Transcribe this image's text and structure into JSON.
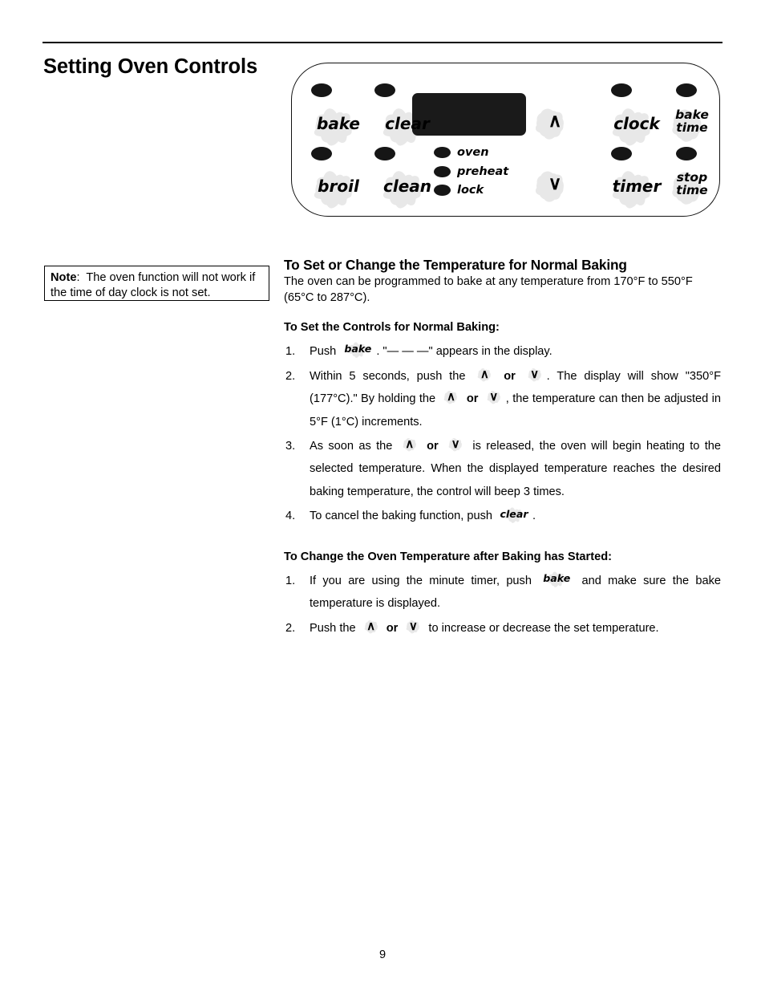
{
  "page": {
    "title": "Setting Oven Controls",
    "number": "9"
  },
  "control_panel": {
    "keys": [
      {
        "id": "bake",
        "label": "bake",
        "has_led": true
      },
      {
        "id": "clear",
        "label": "clear",
        "has_led": true
      },
      {
        "id": "up",
        "label": "∧",
        "has_led": false
      },
      {
        "id": "clock",
        "label": "clock",
        "has_led": true
      },
      {
        "id": "bake-time",
        "label": "bake time",
        "label_line1": "bake",
        "label_line2": "time",
        "has_led": true
      },
      {
        "id": "broil",
        "label": "broil",
        "has_led": true
      },
      {
        "id": "clean",
        "label": "clean",
        "has_led": true
      },
      {
        "id": "down",
        "label": "∨",
        "has_led": false
      },
      {
        "id": "timer",
        "label": "timer",
        "has_led": true
      },
      {
        "id": "stop-time",
        "label": "stop time",
        "label_line1": "stop",
        "label_line2": "time",
        "has_led": true
      }
    ],
    "indicators": [
      {
        "id": "oven",
        "label": "oven"
      },
      {
        "id": "preheat",
        "label": "preheat"
      },
      {
        "id": "lock",
        "label": "lock"
      }
    ],
    "display_window": {
      "label": "digital-display",
      "content": ""
    },
    "colors": {
      "led": "#161616",
      "display": "#1a1a1a",
      "splat": "#e8e8e8",
      "outline": "#111111"
    }
  },
  "note": {
    "label": "Note",
    "separator": ":",
    "text": "The oven function will not work if the time of day clock is not set."
  },
  "section": {
    "title": "To Set or Change the Temperature for Normal Baking",
    "lead": "The oven can be programmed to bake at any temperature from 170°F to 550°F (65°C to 287°C)."
  },
  "procedure_1": {
    "heading": "To Set the Controls for Normal Baking:",
    "steps": [
      {
        "num": "1.",
        "parts": [
          {
            "type": "text",
            "value": "Push "
          },
          {
            "type": "key",
            "value": "bake"
          },
          {
            "type": "text",
            "value": ". \"— — —\" appears in the display."
          }
        ]
      },
      {
        "num": "2.",
        "parts": [
          {
            "type": "text",
            "value": "Within 5 seconds, push the "
          },
          {
            "type": "key",
            "value": "∧"
          },
          {
            "type": "bold",
            "value": " or "
          },
          {
            "type": "key",
            "value": "∨"
          },
          {
            "type": "text",
            "value": ". The display will show \"350°F (177°C).\" By holding the "
          },
          {
            "type": "key",
            "value": "∧"
          },
          {
            "type": "bold",
            "value": " or "
          },
          {
            "type": "key",
            "value": "∨"
          },
          {
            "type": "text",
            "value": ", the temperature can then be adjusted in 5°F (1°C) increments."
          }
        ]
      },
      {
        "num": "3.",
        "parts": [
          {
            "type": "text",
            "value": "As soon as the "
          },
          {
            "type": "key",
            "value": "∧"
          },
          {
            "type": "bold",
            "value": " or "
          },
          {
            "type": "key",
            "value": "∨"
          },
          {
            "type": "text",
            "value": " is released, the oven will begin heating to the selected temperature. When the displayed temperature reaches the desired baking temperature, the control will beep 3 times."
          }
        ]
      },
      {
        "num": "4.",
        "parts": [
          {
            "type": "text",
            "value": "To cancel the baking function, push "
          },
          {
            "type": "key",
            "value": "clear"
          },
          {
            "type": "text",
            "value": "."
          }
        ]
      }
    ]
  },
  "procedure_2": {
    "heading": "To Change the Oven Temperature after Baking has Started:",
    "steps": [
      {
        "num": "1.",
        "parts": [
          {
            "type": "text",
            "value": "If you are using the minute timer, push "
          },
          {
            "type": "key",
            "value": "bake"
          },
          {
            "type": "text",
            "value": " and make sure the bake temperature is displayed."
          }
        ]
      },
      {
        "num": "2.",
        "parts": [
          {
            "type": "text",
            "value": "Push the "
          },
          {
            "type": "key",
            "value": "∧"
          },
          {
            "type": "bold",
            "value": " or "
          },
          {
            "type": "key",
            "value": "∨"
          },
          {
            "type": "text",
            "value": " to increase or decrease the set temperature."
          }
        ]
      }
    ]
  }
}
